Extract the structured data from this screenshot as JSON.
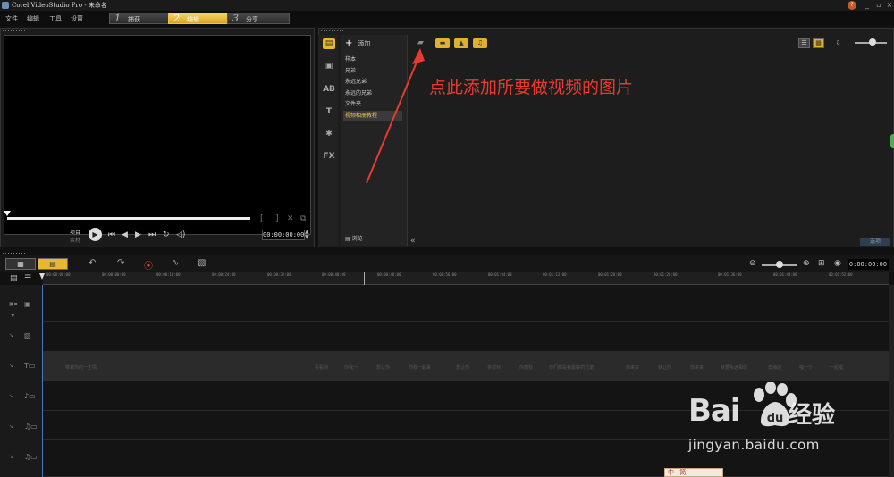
{
  "window": {
    "title": "Corel VideoStudio Pro - 未命名",
    "minimize": "_",
    "restore": "▫",
    "close": "×"
  },
  "menu": [
    "文件",
    "编辑",
    "工具",
    "设置"
  ],
  "steps": [
    {
      "num": "1",
      "label": "捕获"
    },
    {
      "num": "2",
      "label": "编辑"
    },
    {
      "num": "3",
      "label": "分享"
    }
  ],
  "preview": {
    "mode_label": "项目",
    "mode_sub": "素材",
    "timecode": "00:00:00:00"
  },
  "library": {
    "add_label": "添加",
    "folders": [
      "样本",
      "兄弟",
      "永远兄弟",
      "永远的兄弟",
      "文件夹",
      "视频相册教程"
    ],
    "selected_folder_index": 5,
    "browse_label": "浏览",
    "options_label": "选项"
  },
  "annotation": {
    "text": "点此添加所要做视频的图片",
    "color": "#e83a30"
  },
  "timeline": {
    "timecode": "0:00:00:00",
    "ruler_ticks": [
      "00:00:00:00",
      "00:00:08:00",
      "00:00:16:00",
      "00:00:24:00",
      "00:00:32:00",
      "00:00:40:00",
      "00:00:48:00",
      "00:00:56:00",
      "00:01:04:00",
      "00:01:12:00",
      "00:01:20:00",
      "00:01:28:00",
      "00:01:36:00",
      "00:01:44:00",
      "00:01:52:00"
    ],
    "title_clips": [
      "带着你的一生情",
      "看看别",
      "你我一",
      "想让你",
      "你我一起来",
      "想让你",
      "多想对",
      "你想我",
      "你们都是我最好的兄弟",
      "你来来",
      "就让你",
      "你来来",
      "就要永远相信",
      "去海边",
      "唱一个",
      "一起唱"
    ]
  },
  "watermark": {
    "brand": "Bai",
    "brand_suffix": "经验",
    "url": "jingyan.baidu.com"
  },
  "ime": {
    "text": "中",
    "mode": "简"
  },
  "colors": {
    "accent": "#e8b830",
    "annotation": "#e83a30"
  }
}
